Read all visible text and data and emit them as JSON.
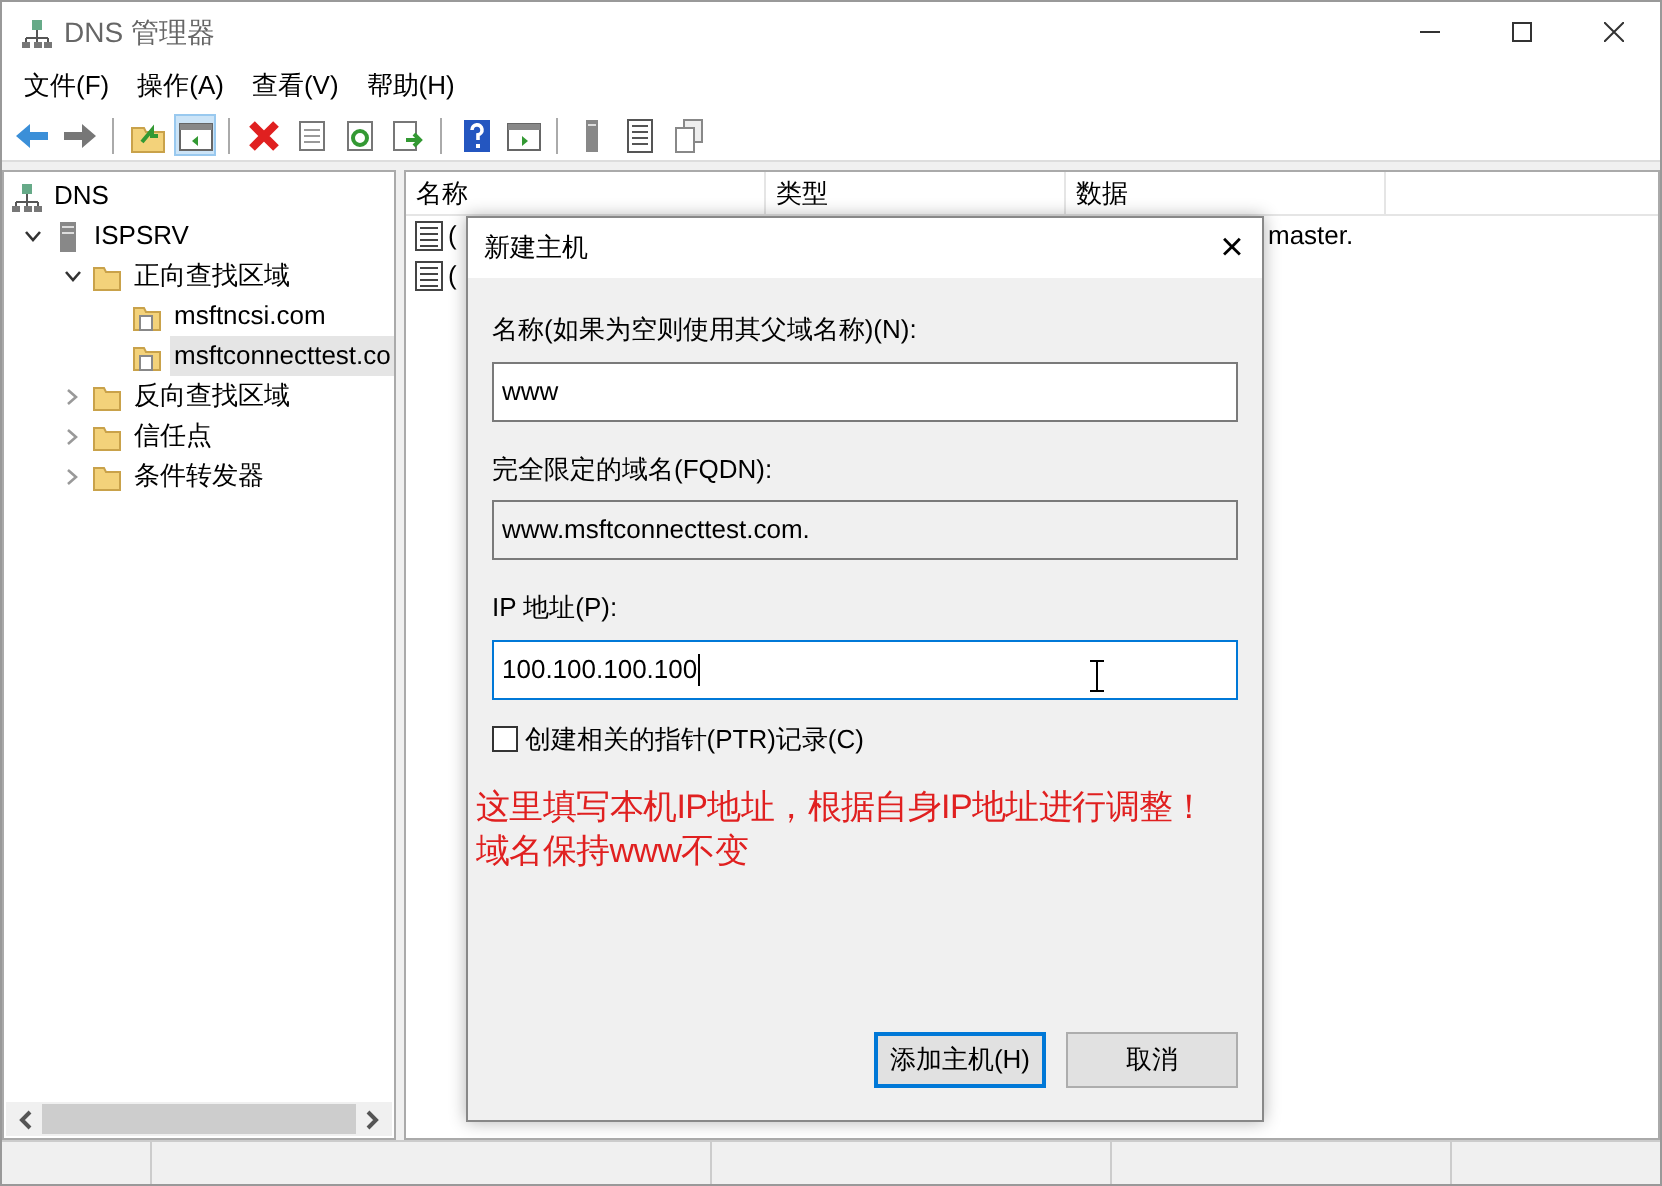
{
  "window": {
    "title": "DNS 管理器"
  },
  "menu": [
    {
      "label": "文件(F)"
    },
    {
      "label": "操作(A)"
    },
    {
      "label": "查看(V)"
    },
    {
      "label": "帮助(H)"
    }
  ],
  "toolbar": [
    {
      "kind": "back",
      "pressed": false
    },
    {
      "kind": "forward",
      "pressed": false
    },
    {
      "kind": "sep"
    },
    {
      "kind": "up",
      "pressed": false
    },
    {
      "kind": "tree",
      "pressed": true
    },
    {
      "kind": "sep"
    },
    {
      "kind": "delete",
      "pressed": false
    },
    {
      "kind": "properties",
      "pressed": false
    },
    {
      "kind": "refresh",
      "pressed": false
    },
    {
      "kind": "export",
      "pressed": false
    },
    {
      "kind": "sep"
    },
    {
      "kind": "help",
      "pressed": false
    },
    {
      "kind": "view",
      "pressed": false
    },
    {
      "kind": "sep"
    },
    {
      "kind": "server",
      "pressed": false
    },
    {
      "kind": "list",
      "pressed": false
    },
    {
      "kind": "copy",
      "pressed": false
    }
  ],
  "tree": [
    {
      "label": "DNS",
      "kind": "dns",
      "selected": false,
      "children": [
        {
          "label": "ISPSRV",
          "kind": "server",
          "expanded": true,
          "selected": false,
          "children": [
            {
              "label": "正向查找区域",
              "kind": "folder",
              "expanded": true,
              "selected": false,
              "children": [
                {
                  "label": "msftncsi.com",
                  "kind": "zone",
                  "selected": false
                },
                {
                  "label": "msftconnecttest.co",
                  "kind": "zone",
                  "selected": true
                }
              ]
            },
            {
              "label": "反向查找区域",
              "kind": "folder",
              "expanded": false,
              "selected": false
            },
            {
              "label": "信任点",
              "kind": "folder",
              "expanded": false,
              "selected": false
            },
            {
              "label": "条件转发器",
              "kind": "folder",
              "expanded": false,
              "selected": false
            }
          ]
        }
      ]
    }
  ],
  "list": {
    "columns": [
      "名称",
      "类型",
      "数据"
    ],
    "rows": [
      {
        "name": "(",
        "data": "master."
      },
      {
        "name": "("
      }
    ]
  },
  "dialog": {
    "title": "新建主机",
    "close": "×",
    "name_label": "名称(如果为空则使用其父域名称)(N):",
    "name_value": "www",
    "fqdn_label": "完全限定的域名(FQDN):",
    "fqdn_value": "www.msftconnecttest.com.",
    "ip_label": "IP 地址(P):",
    "ip_value": "100.100.100.100",
    "ptr": {
      "label": "创建相关的指针(PTR)记录(C)",
      "checked": false
    },
    "annotation": "这里填写本机IP地址，根据自身IP地址进行调整！域名保持www不变",
    "buttons": [
      {
        "label": "添加主机(H)",
        "default": true
      },
      {
        "label": "取消",
        "default": false
      }
    ]
  }
}
